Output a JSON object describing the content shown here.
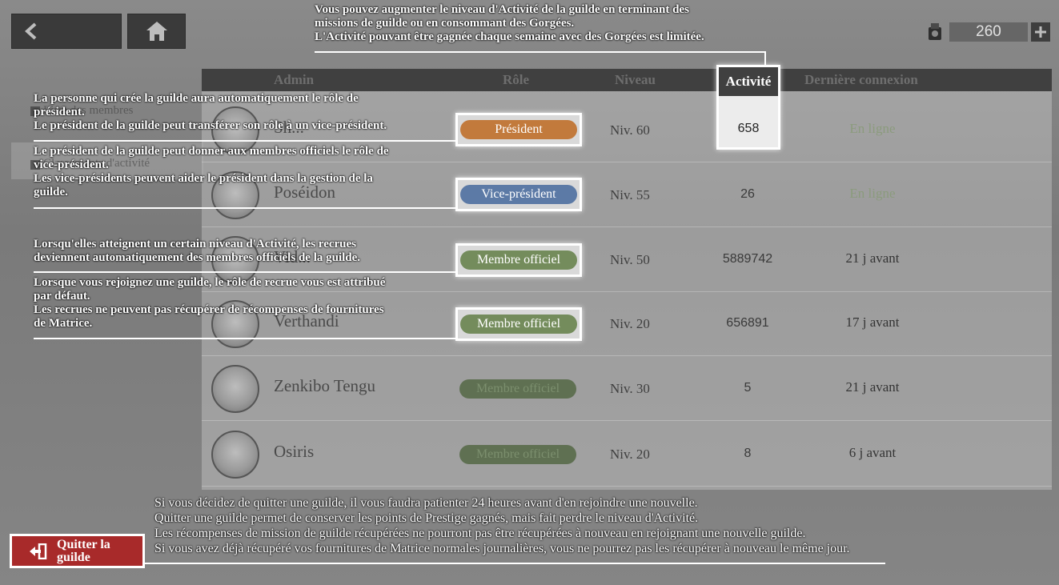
{
  "header": {
    "back_icon": "back-arrow-icon",
    "home_icon": "home-icon",
    "currency": {
      "icon": "gorgee-icon",
      "value": "260",
      "plus_icon": "plus-icon"
    }
  },
  "sidebar": {
    "items": [
      {
        "label": "Liste des membres"
      },
      {
        "label": "Classements d'activité"
      }
    ]
  },
  "table": {
    "headers": {
      "admin": "Admin",
      "role": "Rôle",
      "level": "Niveau",
      "activity": "Activité",
      "last_login": "Dernière connexion"
    },
    "rows": [
      {
        "name": "Sh...",
        "role": "Président",
        "level": "Niv. 60",
        "activity": "658",
        "last_login": "En ligne"
      },
      {
        "name": "Poséidon",
        "role": "Vice-président",
        "level": "Niv. 55",
        "activity": "26",
        "last_login": "En ligne"
      },
      {
        "name": "Vid...",
        "role": "Membre officiel",
        "level": "Niv. 50",
        "activity": "5889742",
        "last_login": "21 j avant"
      },
      {
        "name": "Verthandi",
        "role": "Membre officiel",
        "level": "Niv. 20",
        "activity": "656891",
        "last_login": "17 j avant"
      },
      {
        "name": "Zenkibo Tengu",
        "role": "Membre officiel",
        "level": "Niv. 30",
        "activity": "5",
        "last_login": "21 j avant"
      },
      {
        "name": "Osiris",
        "role": "Membre officiel",
        "level": "Niv. 20",
        "activity": "8",
        "last_login": "6 j avant"
      }
    ]
  },
  "notes": {
    "activity": [
      "Vous pouvez augmenter le niveau d'Activité de la guilde en terminant des",
      "missions de guilde ou en consommant des Gorgées.",
      "L'Activité pouvant être gagnée chaque semaine avec des Gorgées est limitée."
    ],
    "president": [
      "La personne qui crée la guilde aura automatiquement le rôle de",
      "président.",
      "Le président de la guilde peut transférer son rôle à un vice-président."
    ],
    "vice": [
      "Le président de la guilde peut donner aux membres officiels le rôle de",
      "vice-président.",
      "Les vice-présidents peuvent aider le président dans la gestion de la",
      "guilde."
    ],
    "officer": [
      "Lorsqu'elles atteignent un certain niveau d'Activité, les recrues",
      "deviennent automatiquement des membres officiels de la guilde."
    ],
    "recruit": [
      "Lorsque vous rejoignez une guilde, le rôle de recrue vous est attribué",
      "par défaut.",
      "Les recrues ne peuvent pas récupérer de récompenses de fournitures",
      "de Matrice."
    ],
    "quit": [
      "Si vous décidez de quitter une guilde, il vous faudra patienter 24 heures avant d'en rejoindre une nouvelle.",
      "Quitter une guilde permet de conserver les points de Prestige gagnés, mais fait perdre le niveau d'Activité.",
      "Les récompenses de mission de guilde récupérées ne pourront pas être récupérées à nouveau en rejoignant une nouvelle guilde.",
      "Si vous avez déjà récupéré vos fournitures de Matrice normales journalières, vous ne pourrez pas les récupérer à nouveau le même jour."
    ]
  },
  "quit_button": {
    "line1": "Quitter la",
    "line2": "guilde",
    "icon": "exit-door-icon"
  }
}
